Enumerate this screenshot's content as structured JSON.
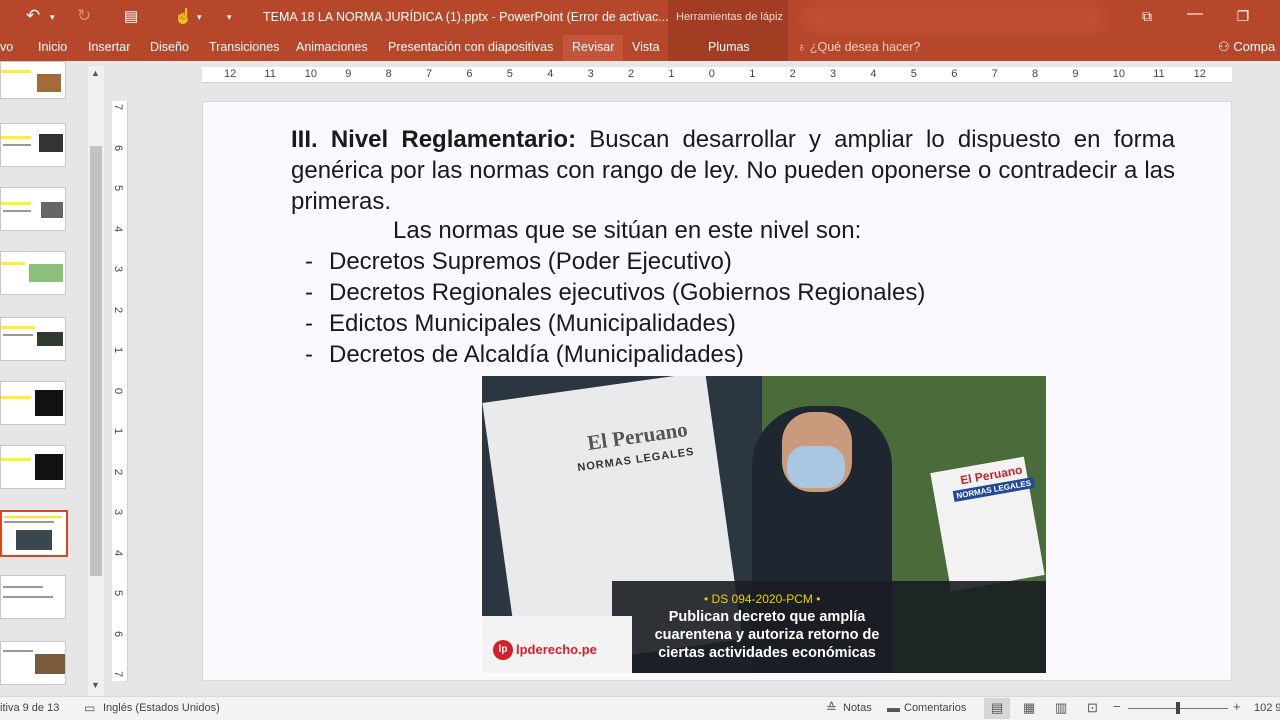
{
  "titlebar": {
    "doc_title": "TEMA 18 LA NORMA JURÍDICA (1).pptx - PowerPoint (Error de activac...",
    "tool_context": "Herramientas de lápiz",
    "icons": [
      "undo-icon",
      "redo-icon",
      "present-from-start-icon",
      "touch-mode-icon",
      "customize-toolbar-icon",
      "ribbon-display-options-icon",
      "minimize-icon",
      "restore-icon"
    ]
  },
  "ribbon": {
    "tabs": [
      "vo",
      "Inicio",
      "Insertar",
      "Diseño",
      "Transiciones",
      "Animaciones",
      "Presentación con diapositivas",
      "Revisar",
      "Vista",
      "Plumas"
    ],
    "active_tab": "Revisar",
    "search_placeholder": "¿Qué desea hacer?",
    "share_label": "Compa"
  },
  "ruler": {
    "horizontal": [
      "12",
      "11",
      "10",
      "9",
      "8",
      "7",
      "6",
      "5",
      "4",
      "3",
      "2",
      "1",
      "0",
      "1",
      "2",
      "3",
      "4",
      "5",
      "6",
      "7",
      "8",
      "9",
      "10",
      "11",
      "12"
    ],
    "vertical": [
      "7",
      "6",
      "5",
      "4",
      "3",
      "2",
      "1",
      "0",
      "1",
      "2",
      "3",
      "4",
      "5",
      "6",
      "7"
    ]
  },
  "slide": {
    "heading_bold": "III. Nivel Reglamentario:",
    "heading_rest": " Buscan desarrollar y ampliar lo dispuesto en forma genérica por las normas con rango de ley.  No pueden oponerse o contradecir a las primeras.",
    "intro": "Las normas que se sitúan en este nivel son:",
    "bullets": [
      "Decretos Supremos (Poder Ejecutivo)",
      "Decretos Regionales ejecutivos (Gobiernos Regionales)",
      "Edictos Municipales (Municipalidades)",
      "Decretos de Alcaldía (Municipalidades)"
    ],
    "bullet_marker": "-",
    "image": {
      "paper_title": "El Peruano",
      "paper_section": "NORMAS LEGALES",
      "newspaper_title": "El Peruano",
      "newspaper_section": "NORMAS LEGALES",
      "tag": "• DS 094-2020-PCM •",
      "headline": "Publican decreto que amplía cuarentena y autoriza retorno de ciertas actividades económicas",
      "logo_badge": "lp",
      "logo_text": "lpderecho.pe"
    }
  },
  "statusbar": {
    "slide_info": "itiva 9 de 13",
    "language": "Inglés (Estados Unidos)",
    "notes": "Notas",
    "comments": "Comentarios",
    "zoom": "102 9"
  },
  "colors": {
    "ribbon": "#b7472a",
    "accent": "#d24726"
  }
}
